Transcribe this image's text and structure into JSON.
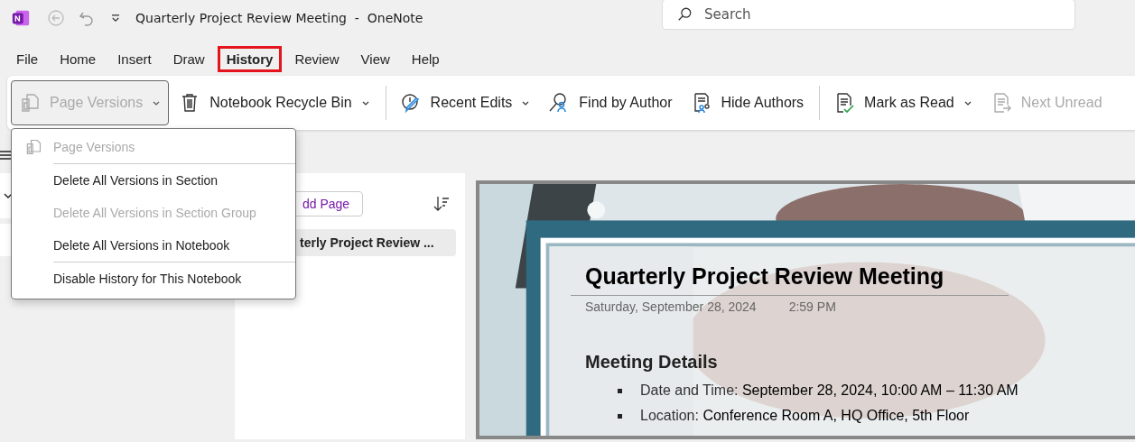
{
  "window": {
    "title": "Quarterly Project Review Meeting  -  OneNote"
  },
  "search": {
    "placeholder": "Search"
  },
  "tabs": [
    {
      "label": "File",
      "selected": false
    },
    {
      "label": "Home",
      "selected": false
    },
    {
      "label": "Insert",
      "selected": false
    },
    {
      "label": "Draw",
      "selected": false
    },
    {
      "label": "History",
      "selected": true
    },
    {
      "label": "Review",
      "selected": false
    },
    {
      "label": "View",
      "selected": false
    },
    {
      "label": "Help",
      "selected": false
    }
  ],
  "ribbon": [
    {
      "label": "Page Versions",
      "disabled": true,
      "open": true,
      "dropdown": true,
      "separator_after": false
    },
    {
      "label": "Notebook Recycle Bin",
      "disabled": false,
      "open": false,
      "dropdown": true,
      "separator_after": true
    },
    {
      "label": "Recent Edits",
      "disabled": false,
      "open": false,
      "dropdown": true,
      "separator_after": false
    },
    {
      "label": "Find by Author",
      "disabled": false,
      "open": false,
      "dropdown": false,
      "separator_after": false
    },
    {
      "label": "Hide Authors",
      "disabled": false,
      "open": false,
      "dropdown": false,
      "separator_after": true
    },
    {
      "label": "Mark as Read",
      "disabled": false,
      "open": false,
      "dropdown": true,
      "separator_after": false
    },
    {
      "label": "Next Unread",
      "disabled": true,
      "open": false,
      "dropdown": false,
      "separator_after": false
    }
  ],
  "menu": [
    {
      "kind": "header",
      "label": "Page Versions",
      "disabled": true,
      "separator_after": true
    },
    {
      "kind": "item",
      "label": "Delete All Versions in Section",
      "disabled": false,
      "separator_after": false
    },
    {
      "kind": "item",
      "label": "Delete All Versions in Section Group",
      "disabled": true,
      "separator_after": false
    },
    {
      "kind": "item",
      "label": "Delete All Versions in Notebook",
      "disabled": false,
      "separator_after": true
    },
    {
      "kind": "item",
      "label": "Disable History for This Notebook",
      "disabled": false,
      "separator_after": false
    }
  ],
  "page_list": {
    "add_button": "dd Page",
    "pages": [
      {
        "title": "terly Project Review ...",
        "selected": true
      }
    ]
  },
  "page": {
    "title": "Quarterly Project Review Meeting",
    "date": "Saturday, September 28, 2024",
    "time": "2:59 PM",
    "heading": "Meeting Details",
    "bullets": [
      {
        "label": "Date and Time:",
        "value": "September 28, 2024, 10:00 AM – 11:30 AM"
      },
      {
        "label": "Location:",
        "value": "Conference Room A, HQ Office, 5th Floor"
      }
    ]
  }
}
